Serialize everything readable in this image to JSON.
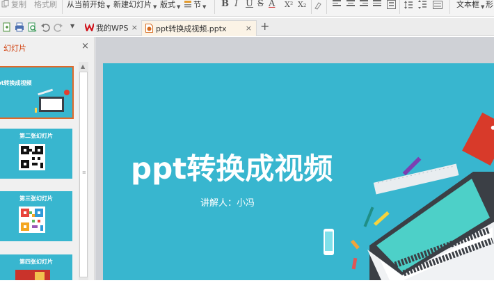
{
  "toolbar": {
    "copy": "复制",
    "format_painter": "格式刷",
    "from_current": "从当前开始",
    "new_slide": "新建幻灯片",
    "layout": "版式",
    "section": "节",
    "bold": "B",
    "italic": "I",
    "underline": "U",
    "strike": "S",
    "font_color": "A",
    "superscript": "X²",
    "subscript": "X₂",
    "textbox": "文本框",
    "shape_partial": "形"
  },
  "tabs": [
    {
      "label": "我的WPS",
      "close": "×"
    },
    {
      "label": "ppt转换成视频.pptx",
      "close": "×"
    }
  ],
  "new_tab": "+",
  "panel": {
    "title": "幻灯片",
    "close": "×",
    "thumbs": [
      {
        "title": "pt转换成视频",
        "selected": true
      },
      {
        "title": "第二张幻灯片"
      },
      {
        "title": "第三张幻灯片"
      },
      {
        "title": "第四张幻灯片"
      }
    ]
  },
  "slide": {
    "title": "ppt转换成视频",
    "subtitle": "讲解人：小冯",
    "background": "#38b6cf"
  },
  "colors": {
    "accent_orange": "#e0692a",
    "wps_red": "#d0121b"
  }
}
